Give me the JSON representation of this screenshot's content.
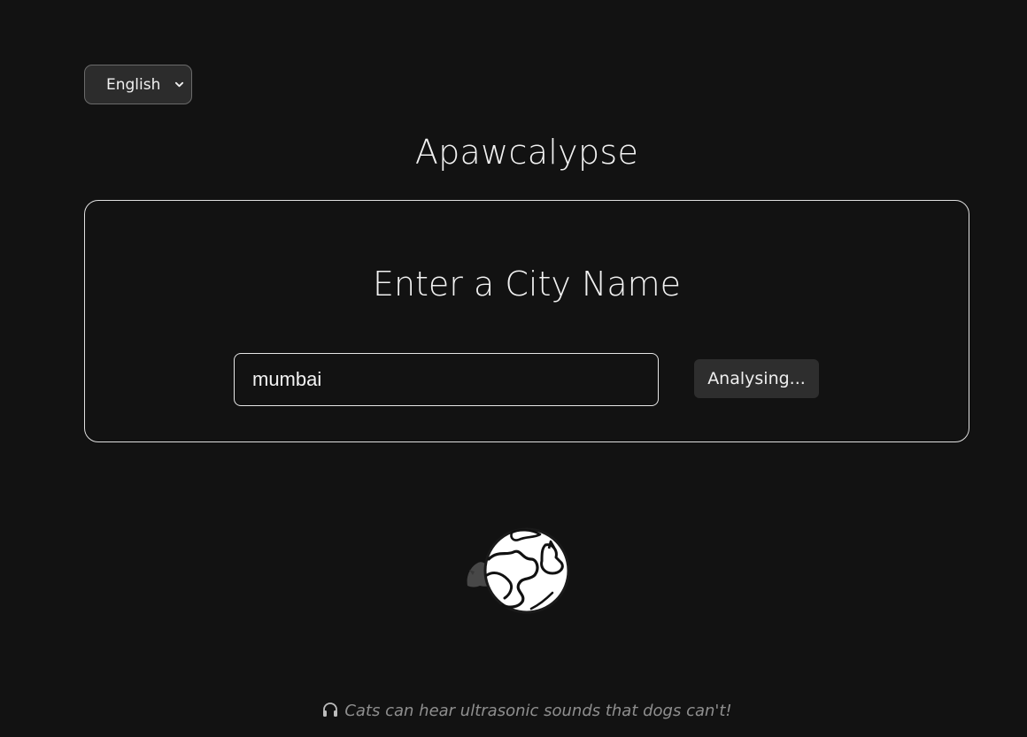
{
  "language_select": {
    "selected": "English",
    "icon": "chevron-down-icon"
  },
  "header": {
    "title": "Apawcalypse"
  },
  "search_card": {
    "heading": "Enter a City Name",
    "city_input_value": "mumbai",
    "analyse_button_label": "Analysing..."
  },
  "loader": {
    "icon": "cat-globe-spinner-icon"
  },
  "footer": {
    "icon": "headphones-icon",
    "fact_text": "Cats can hear ultrasonic sounds that dogs can't!"
  },
  "colors": {
    "background": "#121212",
    "text": "#ececec",
    "border": "#e0e0e0",
    "button_bg": "#2e2e2e",
    "muted_text": "#8f8f8f"
  }
}
